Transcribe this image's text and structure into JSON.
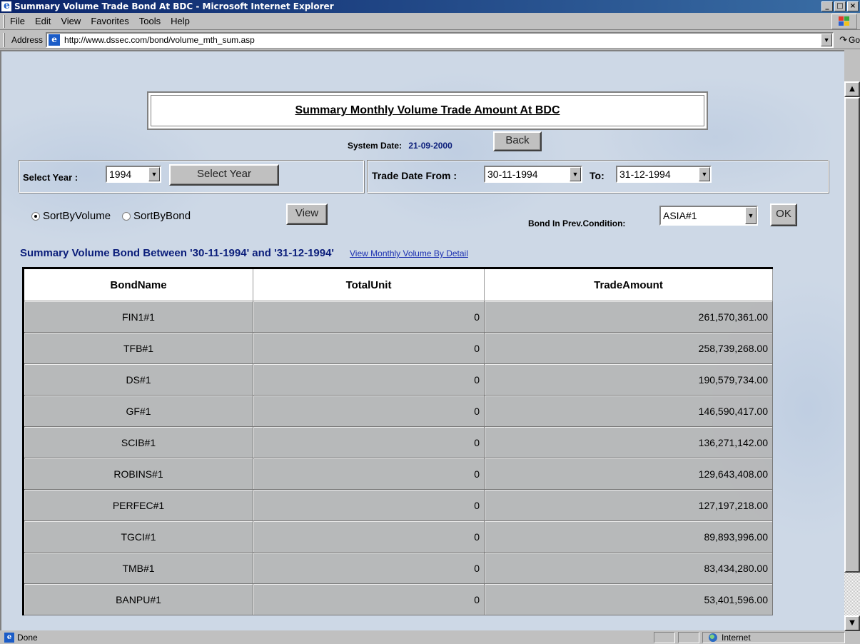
{
  "window": {
    "title": "Summary Volume Trade Bond At BDC - Microsoft Internet Explorer",
    "controls": [
      "_",
      "□",
      "×"
    ]
  },
  "menu": [
    "File",
    "Edit",
    "View",
    "Favorites",
    "Tools",
    "Help"
  ],
  "address": {
    "label": "Address",
    "url": "http://www.dssec.com/bond/volume_mth_sum.asp",
    "go_label": "Go"
  },
  "page": {
    "title": "Summary Monthly Volume Trade Amount At BDC",
    "system_date_label": "System Date:",
    "system_date": "21-09-2000",
    "back_label": "Back",
    "select_year_label": "Select Year :",
    "year": "1994",
    "select_year_button": "Select Year",
    "trade_date_from_label": "Trade Date From :",
    "trade_date_from": "30-11-1994",
    "to_label": "To:",
    "trade_date_to": "31-12-1994",
    "sort_by_volume": "SortByVolume",
    "sort_by_bond": "SortByBond",
    "sort_selected": "volume",
    "view_button": "View",
    "bond_prev_label": "Bond In Prev.Condition:",
    "bond_prev_value": "ASIA#1",
    "ok_button": "OK",
    "summary_heading": "Summary Volume Bond Between '30-11-1994' and '31-12-1994'",
    "detail_link": "View Monthly Volume By Detail"
  },
  "table": {
    "headers": [
      "BondName",
      "TotalUnit",
      "TradeAmount"
    ],
    "rows": [
      [
        "FIN1#1",
        "0",
        "261,570,361.00"
      ],
      [
        "TFB#1",
        "0",
        "258,739,268.00"
      ],
      [
        "DS#1",
        "0",
        "190,579,734.00"
      ],
      [
        "GF#1",
        "0",
        "146,590,417.00"
      ],
      [
        "SCIB#1",
        "0",
        "136,271,142.00"
      ],
      [
        "ROBINS#1",
        "0",
        "129,643,408.00"
      ],
      [
        "PERFEC#1",
        "0",
        "127,197,218.00"
      ],
      [
        "TGCI#1",
        "0",
        "89,893,996.00"
      ],
      [
        "TMB#1",
        "0",
        "83,434,280.00"
      ],
      [
        "BANPU#1",
        "0",
        "53,401,596.00"
      ]
    ]
  },
  "status": {
    "text": "Done",
    "zone": "Internet"
  },
  "icons": {
    "ie": "ie-logo-icon",
    "windows": "windows-logo-icon",
    "go": "go-arrow-icon",
    "globe": "globe-icon"
  },
  "colors": {
    "titlebar": "#0a246a",
    "heading": "#0a1d7a",
    "link": "#1b2fb0"
  }
}
